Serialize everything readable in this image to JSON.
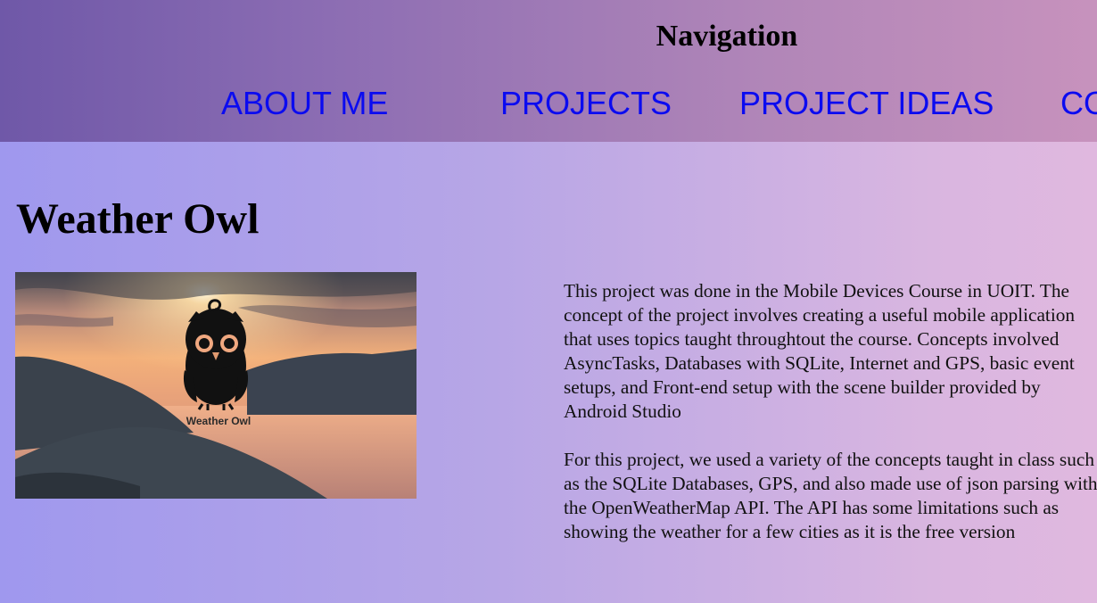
{
  "nav": {
    "title": "Navigation",
    "links": [
      {
        "label": "ABOUT ME"
      },
      {
        "label": "PROJECTS"
      },
      {
        "label": "PROJECT IDEAS"
      },
      {
        "label": "CO"
      }
    ]
  },
  "project": {
    "title": "Weather Owl",
    "image": {
      "logo_text": "Weather Owl"
    },
    "paragraphs": [
      "This project was done in the Mobile Devices Course in UOIT. The concept of the project involves creating a useful mobile application that uses topics taught throughtout the course. Concepts involved AsyncTasks, Databases with SQLite, Internet and GPS, basic event setups, and Front-end setup with the scene builder provided by Android Studio",
      "For this project, we used a variety of the concepts taught in class such as the SQLite Databases, GPS, and also made use of json parsing with the OpenWeatherMap API. The API has some limitations such as showing the weather for a few cities as it is the free version"
    ]
  },
  "colors": {
    "link": "#0b0bf0",
    "nav_bg_start": "#6f58a8",
    "nav_bg_end": "#c792bd",
    "page_bg_start": "#9f98ee",
    "page_bg_end": "#e0b8df"
  }
}
